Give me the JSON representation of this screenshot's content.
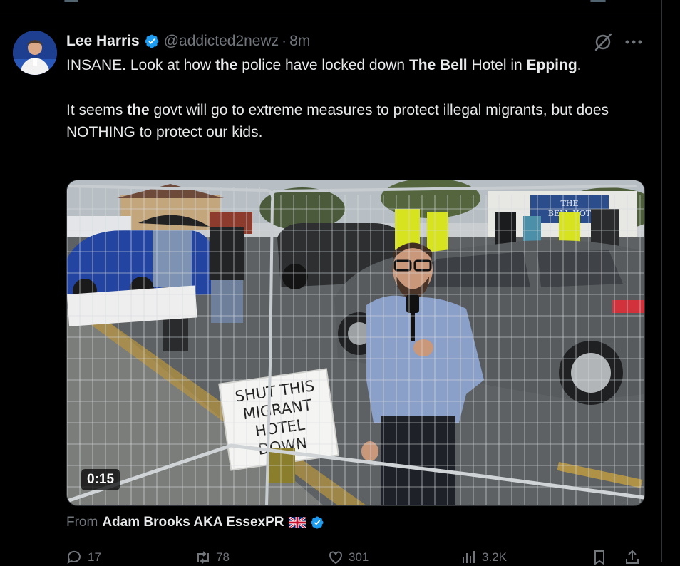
{
  "tweet": {
    "author_name": "Lee Harris",
    "handle": "@addicted2newz",
    "separator": "·",
    "time": "8m",
    "line1_a": "INSANE. Look at how ",
    "line1_b": "the",
    "line1_c": " police have locked down ",
    "line1_d": "The Bell",
    "line1_e": " Hotel in ",
    "line1_f": "Epping",
    "line1_g": ".",
    "line2_a": "It seems ",
    "line2_b": "the",
    "line2_c": " govt will go to extreme measures to protect illegal migrants, but does NOTHING to protect our kids."
  },
  "media": {
    "duration": "0:15",
    "sign_lines": [
      "SHUT THIS",
      "MIGRANT",
      "HOTEL",
      "DOWN"
    ],
    "building_sign_lines": [
      "THE",
      "BELL HOT"
    ]
  },
  "attribution": {
    "label": "From",
    "source_name": "Adam Brooks AKA EssexPR"
  },
  "actions": {
    "replies": "17",
    "reposts": "78",
    "likes": "301",
    "views": "3.2K"
  },
  "colors": {
    "background": "#000000",
    "text": "#e7e9ea",
    "muted": "#71767b",
    "verified": "#1d9bf0",
    "divider": "#2f3336"
  },
  "icons": [
    "verified-badge-icon",
    "grok-icon",
    "more-icon",
    "reply-icon",
    "repost-icon",
    "like-icon",
    "views-icon",
    "bookmark-icon",
    "share-icon",
    "uk-flag-icon"
  ]
}
